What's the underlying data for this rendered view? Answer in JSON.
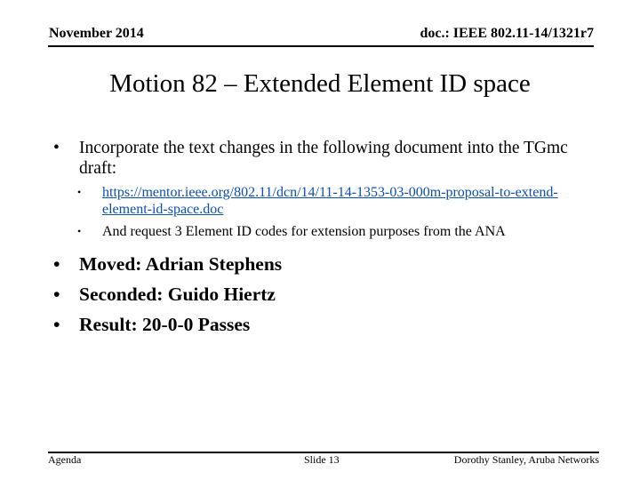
{
  "header": {
    "date": "November 2014",
    "doc_id": "doc.: IEEE 802.11-14/1321r7"
  },
  "slide": {
    "title": "Motion 82  – Extended Element ID space",
    "bullets": [
      {
        "text": "Incorporate the text changes in the following document into the TGmc draft:",
        "sub_bullets": [
          {
            "text": "https://mentor.ieee.org/802.11/dcn/14/11-14-1353-03-000m-proposal-to-extend-element-id-space.doc",
            "is_link": true
          },
          {
            "text": "And request 3 Element ID codes for extension purposes from the ANA",
            "is_link": false
          }
        ]
      }
    ],
    "motion_results": [
      "Moved: Adrian Stephens",
      "Seconded: Guido Hiertz",
      "Result: 20-0-0  Passes"
    ],
    "bullet_glyph": "•"
  },
  "footer": {
    "left": "Agenda",
    "center": "Slide 13",
    "right": "Dorothy Stanley, Aruba Networks"
  },
  "colors": {
    "link": "#0b4fb3",
    "text": "#000000",
    "background": "#ffffff"
  }
}
